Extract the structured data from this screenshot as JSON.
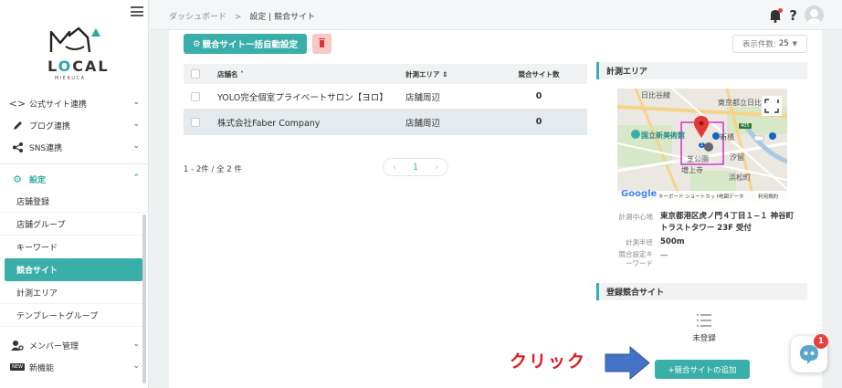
{
  "brand": {
    "logo_text_main": "LOCAL",
    "logo_text_sub": "MIERUCA."
  },
  "sidebar": {
    "items": [
      {
        "label": "公式サイト連携",
        "icon": "code-icon"
      },
      {
        "label": "ブログ連携",
        "icon": "pencil-icon"
      },
      {
        "label": "SNS連携",
        "icon": "share-icon"
      }
    ],
    "settings": {
      "label": "設定",
      "icon": "gear-icon"
    },
    "sub_items": [
      "店舗登録",
      "店舗グループ",
      "キーワード",
      "競合サイト",
      "計測エリア",
      "テンプレートグループ"
    ],
    "active_sub": "競合サイト",
    "bottom_items": [
      {
        "label": "メンバー管理",
        "icon": "member-gear-icon"
      },
      {
        "label": "新機能",
        "icon": "new-badge-icon",
        "badge": "NEW"
      }
    ]
  },
  "header": {
    "breadcrumb": [
      "ダッシュボード",
      "設定 | 競合サイト"
    ],
    "breadcrumb_sep": ">",
    "help": "?"
  },
  "toolbar": {
    "bulk_label": "競合サイト一括自動設定",
    "per_page_label": "表示件数:",
    "per_page_value": "25"
  },
  "table": {
    "columns": [
      "店舗名",
      "計測エリア",
      "競合サイト数"
    ],
    "rows": [
      {
        "name": "YOLO完全個室プライベートサロン【ヨロ】",
        "area": "店舗周辺",
        "count": "0",
        "selected": false
      },
      {
        "name": "株式会社Faber Company",
        "area": "店舗周辺",
        "count": "0",
        "selected": true
      }
    ]
  },
  "pagination": {
    "info": "1 - 2件 / 全 2 件",
    "current_page": "1"
  },
  "area_panel": {
    "title": "計測エリア",
    "map": {
      "labels": [
        "日比谷線",
        "東京都立日比",
        "国立新美術館",
        "新橋",
        "汐留",
        "芝公園",
        "増上寺",
        "浜松町"
      ],
      "shields": [
        "405",
        "1"
      ],
      "footer_brand": "Google",
      "footer_links": [
        "キーボード ショートカット",
        "地図データ",
        "利用規約"
      ]
    },
    "info": [
      {
        "label": "計測中心地",
        "value": "東京都港区虎ノ門４丁目１−１ 神谷町トラストタワー 23F 受付"
      },
      {
        "label": "計測半径",
        "value": "500m"
      },
      {
        "label": "競合設定キーワード",
        "value": "—"
      }
    ]
  },
  "competitor_panel": {
    "title": "登録競合サイト",
    "empty_text": "未登録",
    "add_label": "+競合サイトの追加"
  },
  "annotation": {
    "click_text": "クリック"
  },
  "chat": {
    "badge": "1"
  },
  "colors": {
    "accent": "#3aafa9",
    "danger": "#e5423a",
    "annotation_red": "#e1191e",
    "arrow_blue": "#4472c4"
  }
}
